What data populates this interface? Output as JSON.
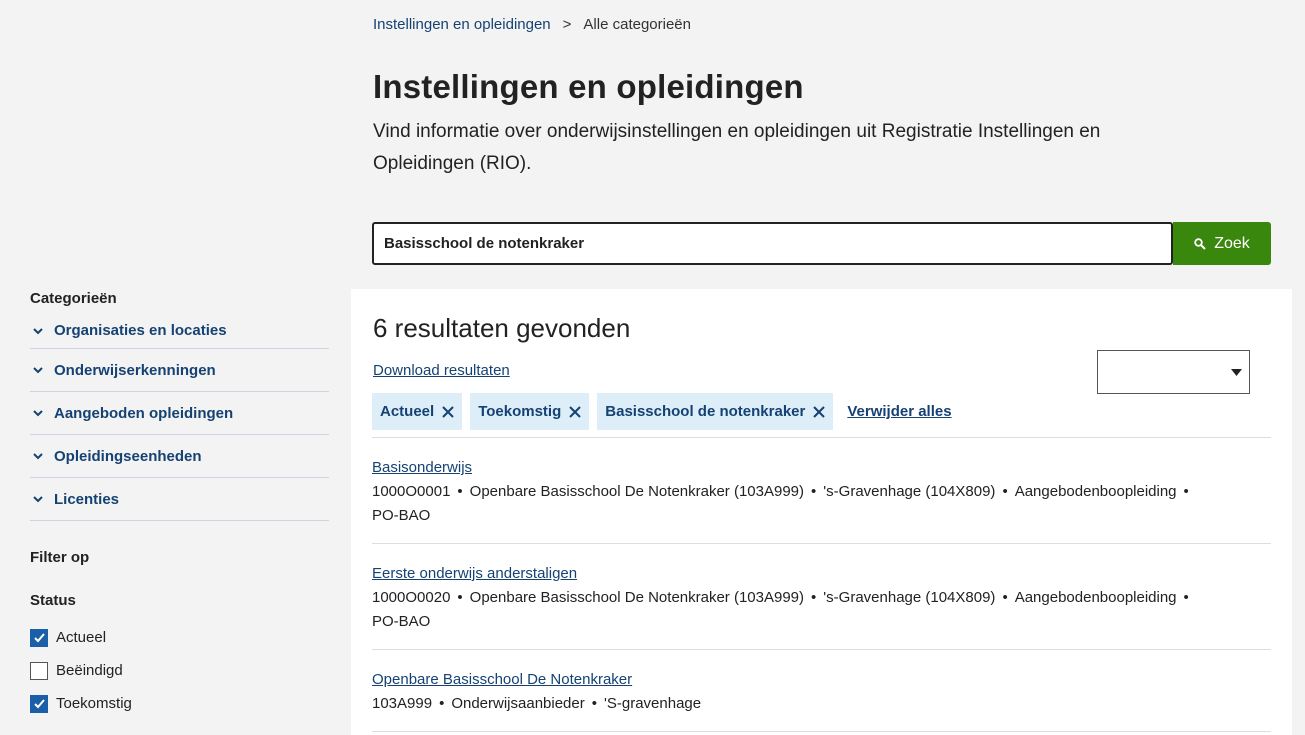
{
  "breadcrumb": {
    "items": [
      {
        "label": "Instellingen en opleidingen"
      },
      {
        "label": "Alle categorieën"
      }
    ],
    "separator": ">"
  },
  "page": {
    "title": "Instellingen en opleidingen",
    "intro": "Vind informatie over onderwijsinstellingen en opleidingen uit Registratie Instellingen en Opleidingen (RIO)."
  },
  "search": {
    "value": "Basisschool de notenkraker",
    "button_label": "Zoek"
  },
  "sidebar": {
    "categories_heading": "Categorieën",
    "categories": [
      {
        "label": "Organisaties en locaties"
      },
      {
        "label": "Onderwijserkenningen"
      },
      {
        "label": "Aangeboden opleidingen"
      },
      {
        "label": "Opleidingseenheden"
      },
      {
        "label": "Licenties"
      }
    ],
    "filter_heading": "Filter op",
    "status_heading": "Status",
    "status_options": [
      {
        "label": "Actueel",
        "checked": true
      },
      {
        "label": "Beëindigd",
        "checked": false
      },
      {
        "label": "Toekomstig",
        "checked": true
      }
    ]
  },
  "results": {
    "count_text": "6 resultaten gevonden",
    "download_label": "Download resultaten",
    "sort_value": "",
    "chips": [
      {
        "label": "Actueel"
      },
      {
        "label": "Toekomstig"
      },
      {
        "label": "Basisschool de notenkraker"
      }
    ],
    "clear_all_label": "Verwijder alles",
    "items": [
      {
        "title": "Basisonderwijs",
        "meta": [
          "1000O0001",
          "Openbare Basisschool De Notenkraker (103A999)",
          "'s-Gravenhage (104X809)",
          "Aangebodenboopleiding"
        ],
        "meta_line2": "PO-BAO"
      },
      {
        "title": "Eerste onderwijs anderstaligen",
        "meta": [
          "1000O0020",
          "Openbare Basisschool De Notenkraker (103A999)",
          "'s-Gravenhage (104X809)",
          "Aangebodenboopleiding"
        ],
        "meta_line2": "PO-BAO"
      },
      {
        "title": "Openbare Basisschool De Notenkraker",
        "meta": [
          "103A999",
          "Onderwijsaanbieder",
          "'S-gravenhage"
        ],
        "meta_line2": ""
      }
    ]
  },
  "colors": {
    "link": "#154273",
    "button_green": "#39870c",
    "chip_bg": "#ddeef9",
    "checkbox_checked": "#1a5fa8",
    "page_bg": "#f3f3f3"
  }
}
